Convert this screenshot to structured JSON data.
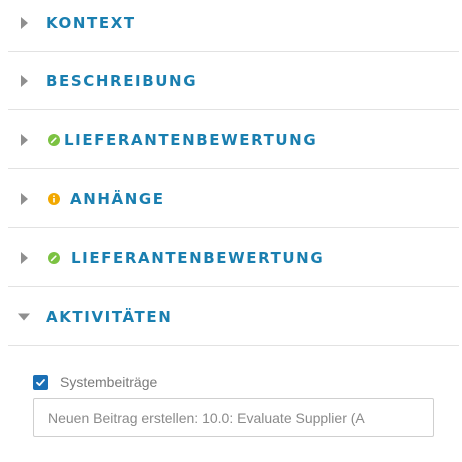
{
  "sections": [
    {
      "label": "KONTEXT",
      "expanded": false,
      "status": null
    },
    {
      "label": "BESCHREIBUNG",
      "expanded": false,
      "status": null
    },
    {
      "label": "LIEFERANTENBEWERTUNG",
      "expanded": false,
      "status": "check-circle-icon"
    },
    {
      "label": "ANHÄNGE",
      "expanded": false,
      "status": "info-circle-icon"
    },
    {
      "label": "LIEFERANTENBEWERTUNG",
      "expanded": false,
      "status": "check-circle-icon"
    },
    {
      "label": "AKTIVITÄTEN",
      "expanded": true,
      "status": null
    }
  ],
  "activities": {
    "system_posts_label": "Systembeiträge",
    "system_posts_checked": true,
    "new_post_placeholder": "Neuen Beitrag erstellen: 10.0: Evaluate Supplier (A"
  },
  "colors": {
    "section_label": "#1a7fb0",
    "ok_status": "#7cc242",
    "info_status": "#f2a800",
    "checkbox": "#1a6fb5"
  }
}
